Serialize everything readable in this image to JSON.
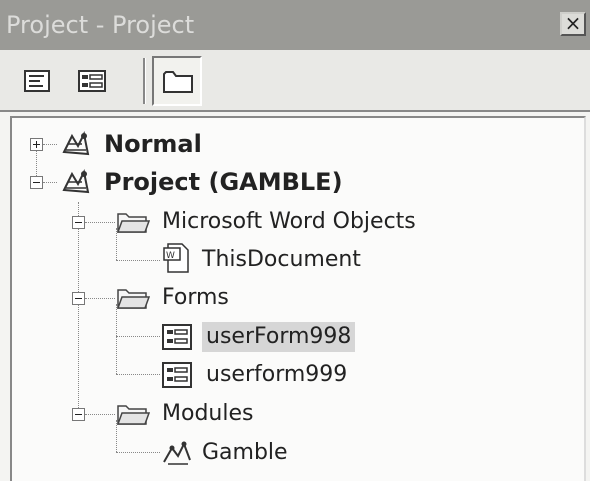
{
  "window": {
    "title": "Project - Project",
    "close_glyph": "×"
  },
  "toolbar": {
    "buttons": [
      {
        "name": "view-code",
        "icon": "view-code-icon"
      },
      {
        "name": "view-object",
        "icon": "view-object-icon"
      },
      {
        "name": "toggle-folders",
        "icon": "folder-icon",
        "pressed": true
      }
    ]
  },
  "tree": {
    "normal": {
      "label": "Normal",
      "expanded": false
    },
    "project": {
      "label": "Project (GAMBLE)",
      "expanded": true
    },
    "word_objects": {
      "label": "Microsoft Word Objects",
      "expanded": true
    },
    "this_document": {
      "label": "ThisDocument"
    },
    "forms": {
      "label": "Forms",
      "expanded": true
    },
    "form1": {
      "label": "userForm998",
      "selected": true
    },
    "form2": {
      "label": "userform999"
    },
    "modules": {
      "label": "Modules",
      "expanded": true
    },
    "module1": {
      "label": "Gamble"
    }
  }
}
